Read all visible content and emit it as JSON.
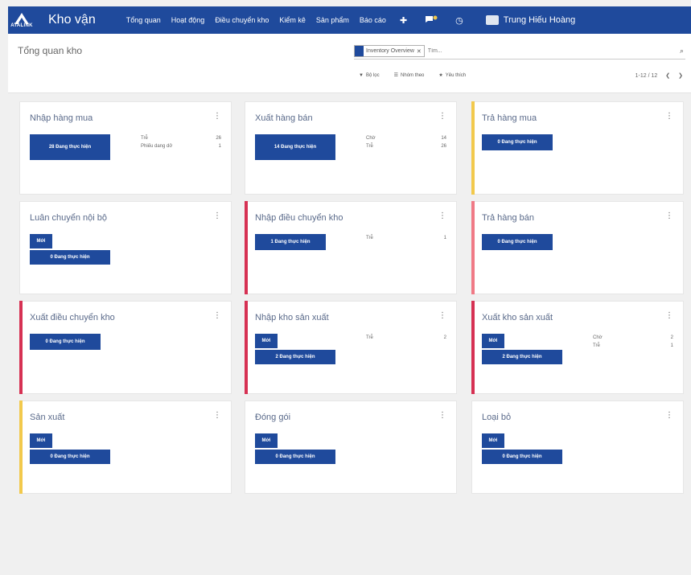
{
  "app": {
    "logo_text": "ATALINK",
    "title": "Kho vận"
  },
  "nav": {
    "items": [
      "Tổng quan",
      "Hoạt động",
      "Điều chuyển kho",
      "Kiểm kê",
      "Sản phẩm",
      "Báo cáo"
    ],
    "user_name": "Trung Hiếu Hoàng"
  },
  "control": {
    "breadcrumb": "Tổng quan kho",
    "facet_label": "Inventory Overview",
    "search_placeholder": "Tìm...",
    "filter_label": "Bộ lọc",
    "group_label": "Nhóm theo",
    "favorites_label": "Yêu thích",
    "pager_value": "1-12 / 12"
  },
  "cards": [
    {
      "title": "Nhập hàng mua",
      "color": "",
      "buttons": [
        "28 Đang thực hiện"
      ],
      "stats": [
        {
          "label": "Trễ",
          "value": "26"
        },
        {
          "label": "Phiếu dang dở",
          "value": "1"
        }
      ]
    },
    {
      "title": "Xuất hàng bán",
      "color": "",
      "buttons": [
        "14 Đang thực hiện"
      ],
      "stats": [
        {
          "label": "Chờ",
          "value": "14"
        },
        {
          "label": "Trễ",
          "value": "26"
        }
      ]
    },
    {
      "title": "Trả hàng mua",
      "color": "#f2c94c",
      "buttons": [
        "0 Đang thực hiện"
      ],
      "stats": []
    },
    {
      "title": "Luân chuyển nội bộ",
      "color": "",
      "buttons": [
        "Mới",
        "0 Đang thực hiện"
      ],
      "stats": []
    },
    {
      "title": "Nhập điều chuyển kho",
      "color": "#d63153",
      "buttons": [
        "1 Đang thực hiện"
      ],
      "stats": [
        {
          "label": "Trễ",
          "value": "1"
        }
      ]
    },
    {
      "title": "Trả hàng bán",
      "color": "#f07a86",
      "buttons": [
        "0 Đang thực hiện"
      ],
      "stats": []
    },
    {
      "title": "Xuất điều chuyển kho",
      "color": "#d63153",
      "buttons": [
        "0 Đang thực hiện"
      ],
      "stats": []
    },
    {
      "title": "Nhập kho sản xuất",
      "color": "#d63153",
      "buttons": [
        "Mới",
        "2 Đang thực hiện"
      ],
      "stats": [
        {
          "label": "Trễ",
          "value": "2"
        }
      ]
    },
    {
      "title": "Xuất kho sản xuất",
      "color": "#d63153",
      "buttons": [
        "Mới",
        "2 Đang thực hiện"
      ],
      "stats": [
        {
          "label": "Chờ",
          "value": "2"
        },
        {
          "label": "Trễ",
          "value": "1"
        }
      ]
    },
    {
      "title": "Sản xuất",
      "color": "#f2c94c",
      "buttons": [
        "Mới",
        "0 Đang thực hiện"
      ],
      "stats": []
    },
    {
      "title": "Đóng gói",
      "color": "",
      "buttons": [
        "Mới",
        "0 Đang thực hiện"
      ],
      "stats": []
    },
    {
      "title": "Loại bỏ",
      "color": "",
      "buttons": [
        "Mới",
        "0 Đang thực hiện"
      ],
      "stats": []
    }
  ],
  "card_menu": "⋮",
  "colors": {
    "brand": "#1f4a9c",
    "late": "#d63153",
    "warning": "#f2c94c"
  }
}
